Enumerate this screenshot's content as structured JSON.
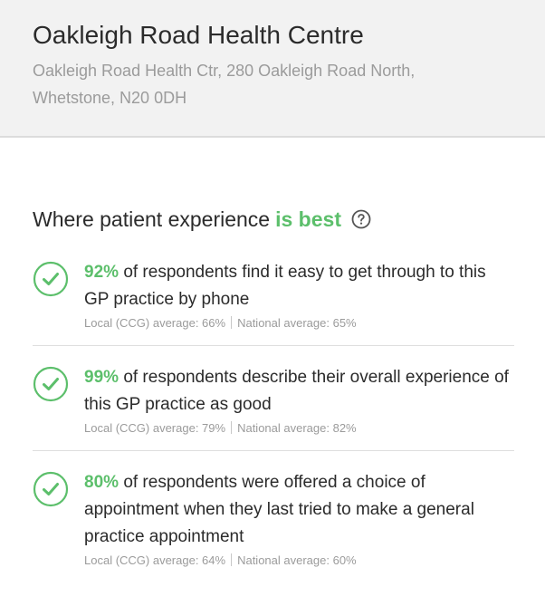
{
  "header": {
    "title": "Oakleigh Road Health Centre",
    "address": "Oakleigh Road Health Ctr, 280 Oakleigh Road North, Whetstone, N20 0DH"
  },
  "section": {
    "title_prefix": "Where patient experience",
    "title_highlight": "is best",
    "help_icon": "question-circle-icon"
  },
  "colors": {
    "accent_green": "#5cbf6b",
    "muted_text": "#9b9b9b",
    "header_bg": "#f2f2f2"
  },
  "items": [
    {
      "icon": "check-circle-icon",
      "percent": "92%",
      "text": "of respondents find it easy to get through to this GP practice by phone",
      "local": "Local (CCG) average: 66%",
      "national": "National average: 65%"
    },
    {
      "icon": "check-circle-icon",
      "percent": "99%",
      "text": "of respondents describe their overall experience of this GP practice as good",
      "local": "Local (CCG) average: 79%",
      "national": "National average: 82%"
    },
    {
      "icon": "check-circle-icon",
      "percent": "80%",
      "text": "of respondents were offered a choice of appointment when they last tried to make a general practice appointment",
      "local": "Local (CCG) average: 64%",
      "national": "National average: 60%"
    }
  ]
}
